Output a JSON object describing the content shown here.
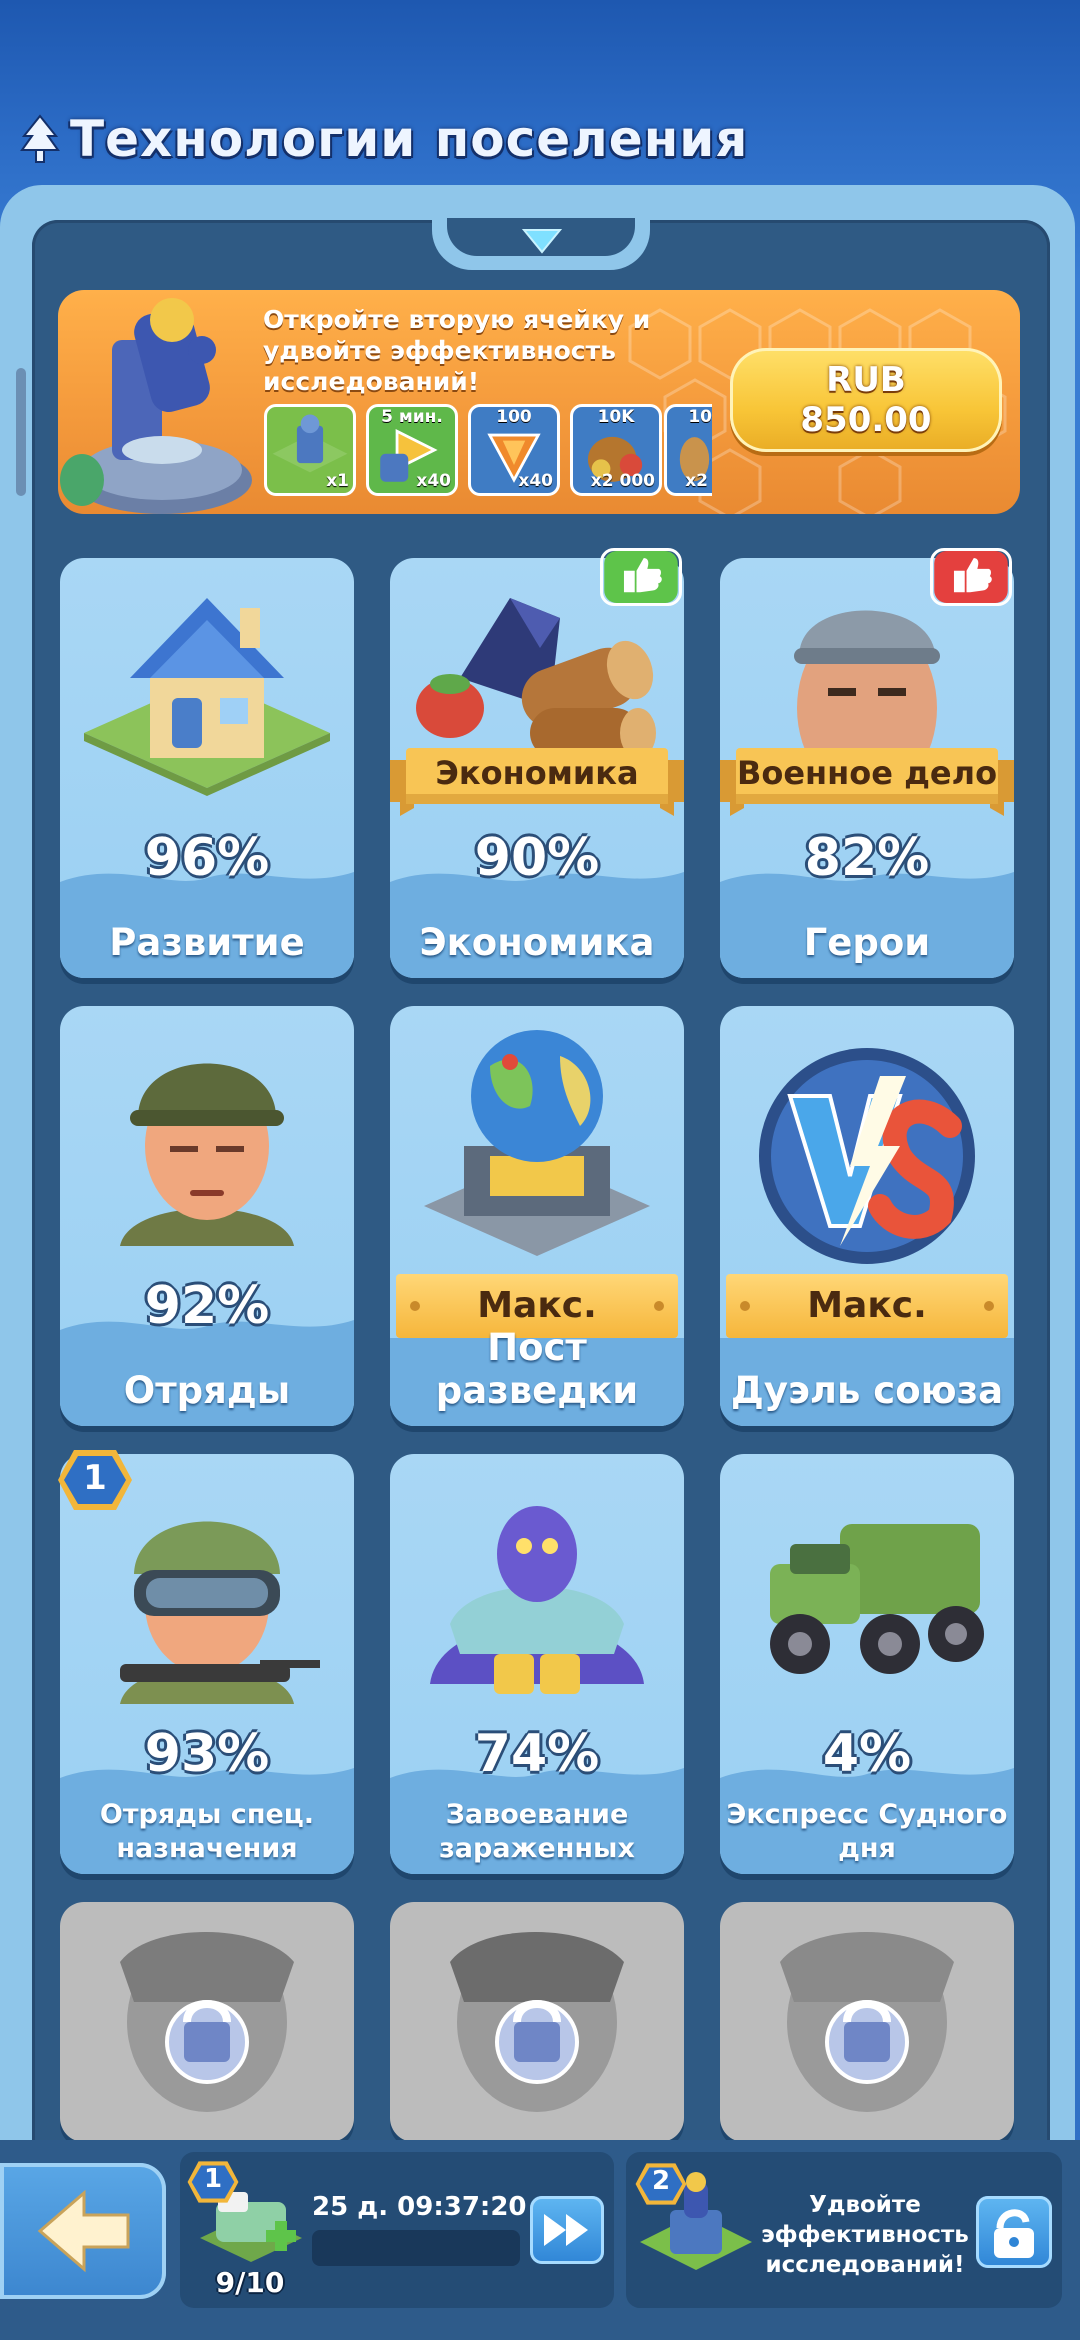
{
  "header": {
    "title": "Технологии поселения"
  },
  "promo": {
    "text": "Откройте вторую ячейку и удвойте эффективность исследований!",
    "price_line1": "RUB",
    "price_line2": "850.00",
    "rewards": [
      {
        "top": "",
        "count": "x1"
      },
      {
        "top": "5 мин.",
        "count": "x40"
      },
      {
        "top": "100",
        "count": "x40"
      },
      {
        "top": "10K",
        "count": "x2 000"
      },
      {
        "top": "10",
        "count": "x2"
      }
    ]
  },
  "cards": [
    {
      "percent": "96%",
      "label": "Развитие"
    },
    {
      "percent": "90%",
      "label": "Экономика",
      "ribbon": "Экономика"
    },
    {
      "percent": "82%",
      "label": "Герои",
      "ribbon": "Военное дело"
    },
    {
      "percent": "92%",
      "label": "Отряды"
    },
    {
      "max": "Макс.",
      "label": "Пост разведки"
    },
    {
      "max": "Макс.",
      "label": "Дуэль союза"
    },
    {
      "percent": "93%",
      "label": "Отряды спец. назначения",
      "badge": "1"
    },
    {
      "percent": "74%",
      "label": "Завоевание зараженных"
    },
    {
      "percent": "4%",
      "label": "Экспресс Судного дня"
    }
  ],
  "bottom": {
    "slot1_badge": "1",
    "timer": "25 д. 09:37:20",
    "count": "9/10",
    "slot2_badge": "2",
    "slot2_text": "Удвойте эффективность исследований!"
  },
  "colors": {
    "accent": "#f8c537",
    "panel": "#2f5a84",
    "card": "#a9d7f5"
  }
}
